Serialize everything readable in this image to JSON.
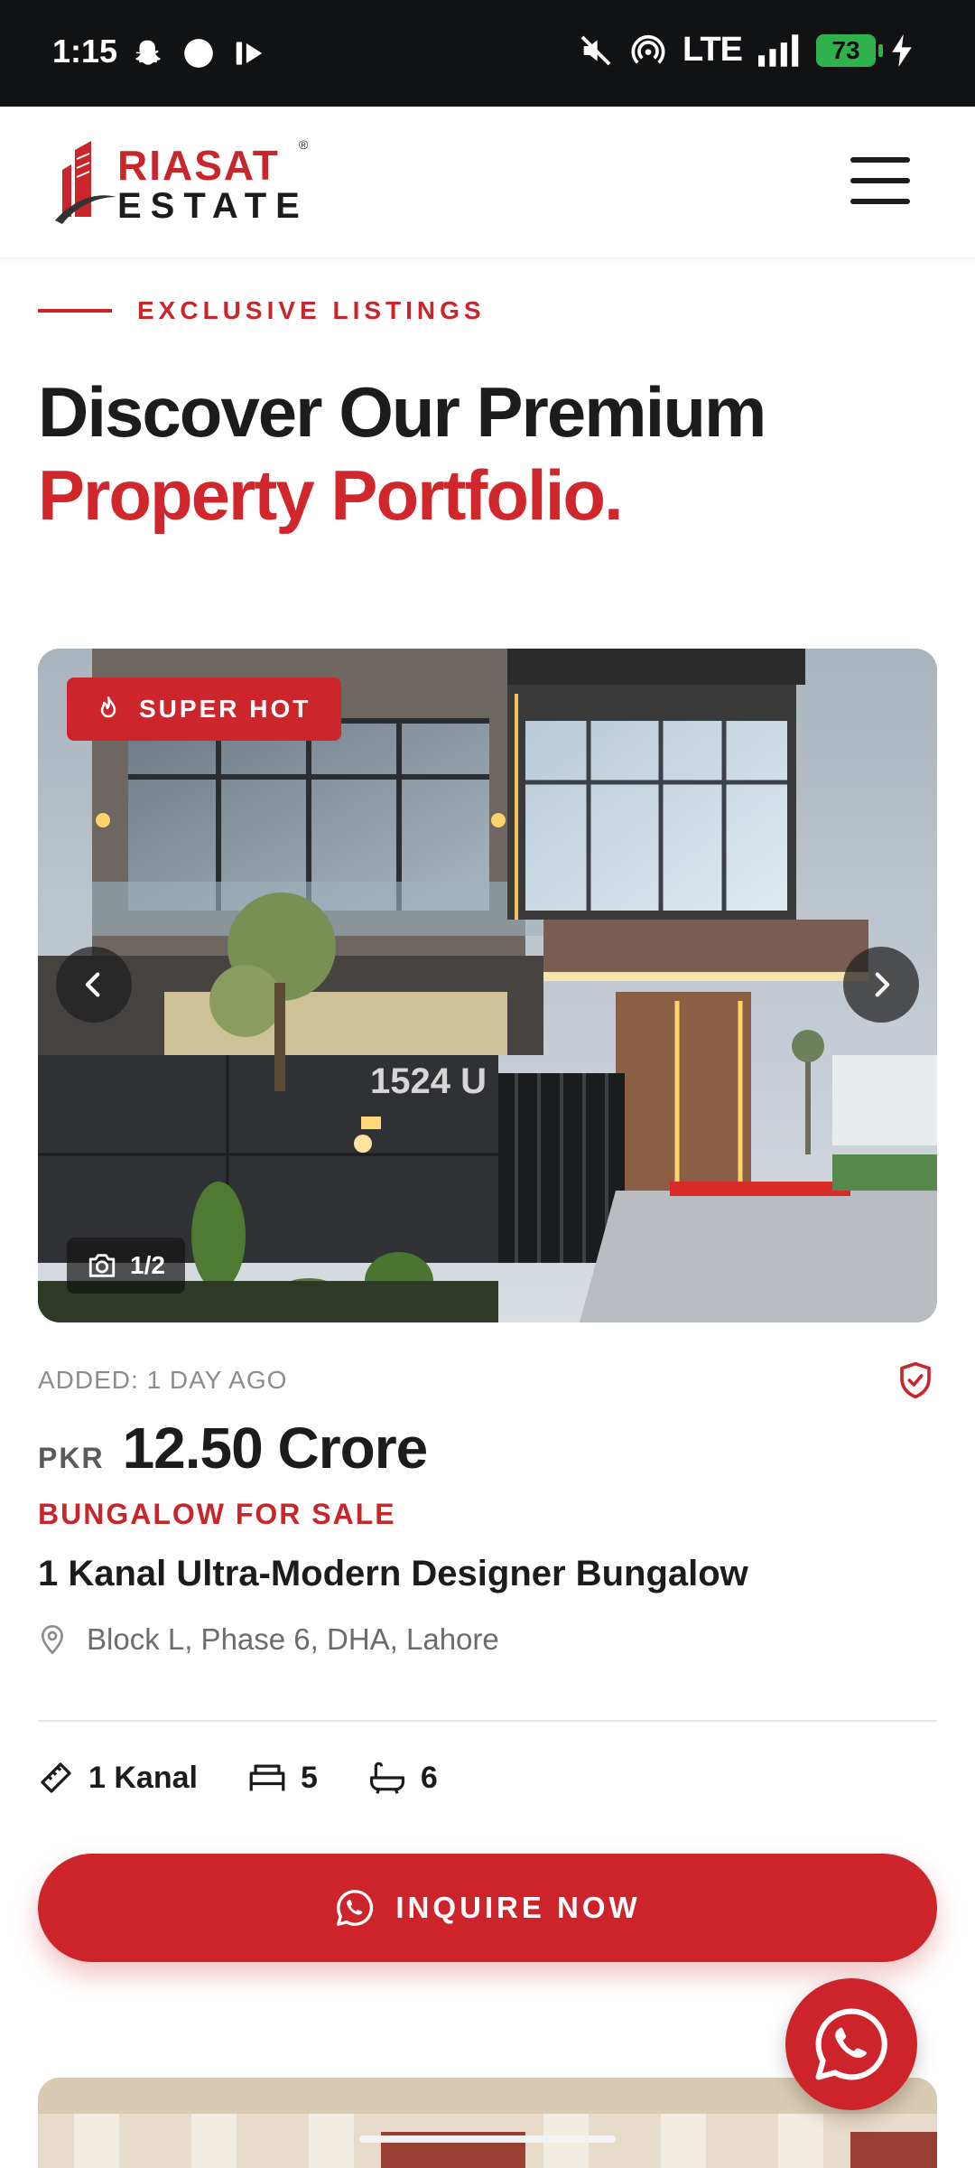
{
  "status_bar": {
    "time": "1:15",
    "network": "LTE",
    "battery": "73"
  },
  "header": {
    "logo_line1": "RIASAT",
    "logo_line2": "ESTATE",
    "logo_mark": "®"
  },
  "section": {
    "eyebrow": "EXCLUSIVE LISTINGS",
    "headline_line1": "Discover Our Premium",
    "headline_line2": "Property Portfolio."
  },
  "listing": {
    "badge": "SUPER HOT",
    "image_counter": "1/2",
    "added": "ADDED: 1 DAY AGO",
    "price_currency": "PKR",
    "price_value": "12.50 Crore",
    "type": "BUNGALOW FOR SALE",
    "title": "1 Kanal Ultra-Modern Designer Bungalow",
    "location": "Block L, Phase 6, DHA, Lahore",
    "area": "1 Kanal",
    "beds": "5",
    "baths": "6",
    "house_number": "1524 U",
    "cta": "INQUIRE NOW"
  },
  "colors": {
    "brand_red": "#cd242b",
    "text_dark": "#1c1c1c",
    "muted": "#8c8c8c"
  },
  "icons": [
    "snapchat-icon",
    "circle-icon",
    "play-icon",
    "mute-icon",
    "hotspot-icon",
    "signal-icon",
    "battery-icon",
    "menu-icon",
    "flame-icon",
    "chevron-left-icon",
    "chevron-right-icon",
    "camera-icon",
    "shield-check-icon",
    "location-pin-icon",
    "ruler-icon",
    "bed-icon",
    "bath-icon",
    "whatsapp-icon"
  ]
}
